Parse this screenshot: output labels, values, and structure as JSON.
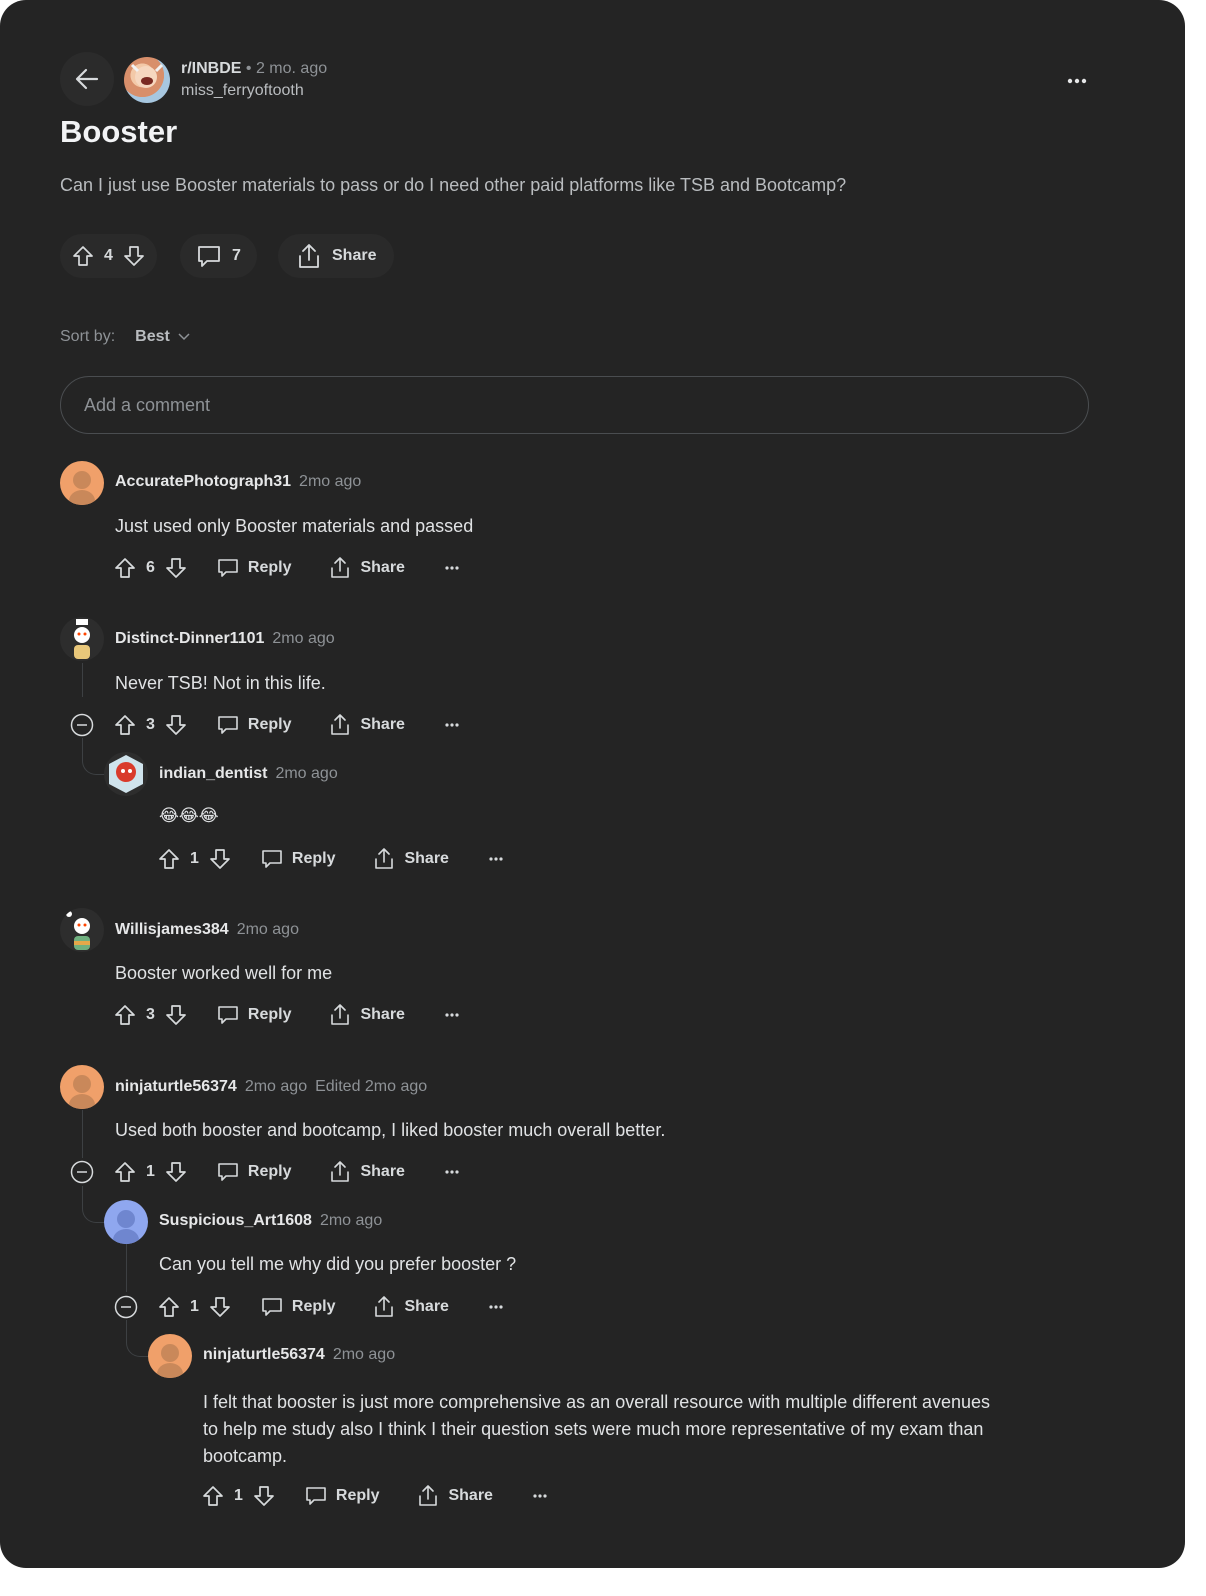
{
  "post": {
    "subreddit": "r/INBDE",
    "time": "2 mo. ago",
    "author": "miss_ferryoftooth",
    "title": "Booster",
    "body": "Can I just use Booster materials to pass or do I need other paid platforms like TSB and Bootcamp?",
    "votes": "4",
    "comments_count": "7",
    "share_label": "Share"
  },
  "sort": {
    "label": "Sort by:",
    "value": "Best"
  },
  "comment_box": {
    "placeholder": "Add a comment"
  },
  "actions": {
    "reply": "Reply",
    "share": "Share"
  },
  "comments": [
    {
      "user": "AccuratePhotograph31",
      "meta": "2mo ago",
      "text": "Just used only Booster materials and passed",
      "votes": "6"
    },
    {
      "user": "Distinct-Dinner1101",
      "meta": "2mo ago",
      "text": "Never TSB! Not in this life.",
      "votes": "3"
    },
    {
      "user": "indian_dentist",
      "meta": "2mo ago",
      "text": "😂😂😂",
      "votes": "1"
    },
    {
      "user": "Willisjames384",
      "meta": "2mo ago",
      "text": "Booster worked well for me",
      "votes": "3"
    },
    {
      "user": "ninjaturtle56374",
      "meta": "2mo ago",
      "edited": "Edited 2mo ago",
      "text": "Used both booster and bootcamp, I liked booster much overall better.",
      "votes": "1"
    },
    {
      "user": "Suspicious_Art1608",
      "meta": "2mo ago",
      "text": "Can you tell me why did you prefer booster ?",
      "votes": "1"
    },
    {
      "user": "ninjaturtle56374",
      "meta": "2mo ago",
      "text_lines": [
        "I felt that booster is just more comprehensive as an overall resource with multiple different avenues",
        "to help me study also I think I their question sets were much more representative of my exam than",
        "bootcamp."
      ],
      "votes": "1"
    }
  ]
}
